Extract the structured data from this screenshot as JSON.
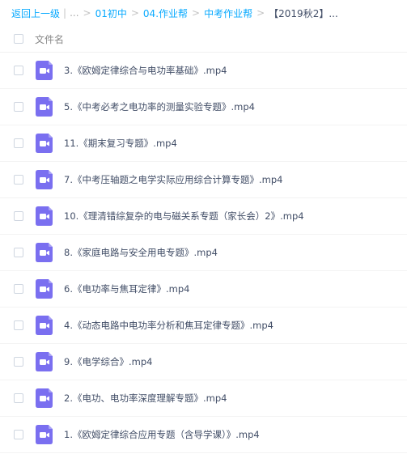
{
  "breadcrumb": {
    "back": "返回上一级",
    "ellipsis": "...",
    "items": [
      "01初中",
      "04.作业帮",
      "中考作业帮"
    ],
    "current": "【2019秋2】..."
  },
  "table": {
    "column_title": "文件名"
  },
  "files": [
    {
      "name": "3.《欧姆定律综合与电功率基础》.mp4"
    },
    {
      "name": "5.《中考必考之电功率的测量实验专题》.mp4"
    },
    {
      "name": "11.《期末复习专题》.mp4"
    },
    {
      "name": "7.《中考压轴题之电学实际应用综合计算专题》.mp4"
    },
    {
      "name": "10.《理清错综复杂的电与磁关系专题（家长会）2》.mp4"
    },
    {
      "name": "8.《家庭电路与安全用电专题》.mp4"
    },
    {
      "name": "6.《电功率与焦耳定律》.mp4"
    },
    {
      "name": "4.《动态电路中电功率分析和焦耳定律专题》.mp4"
    },
    {
      "name": "9.《电学综合》.mp4"
    },
    {
      "name": "2.《电功、电功率深度理解专题》.mp4"
    },
    {
      "name": "1.《欧姆定律综合应用专题（含导学课）》.mp4"
    }
  ],
  "icons": {
    "video_file": "video-file-icon",
    "video_color": "#7a6ff0"
  }
}
